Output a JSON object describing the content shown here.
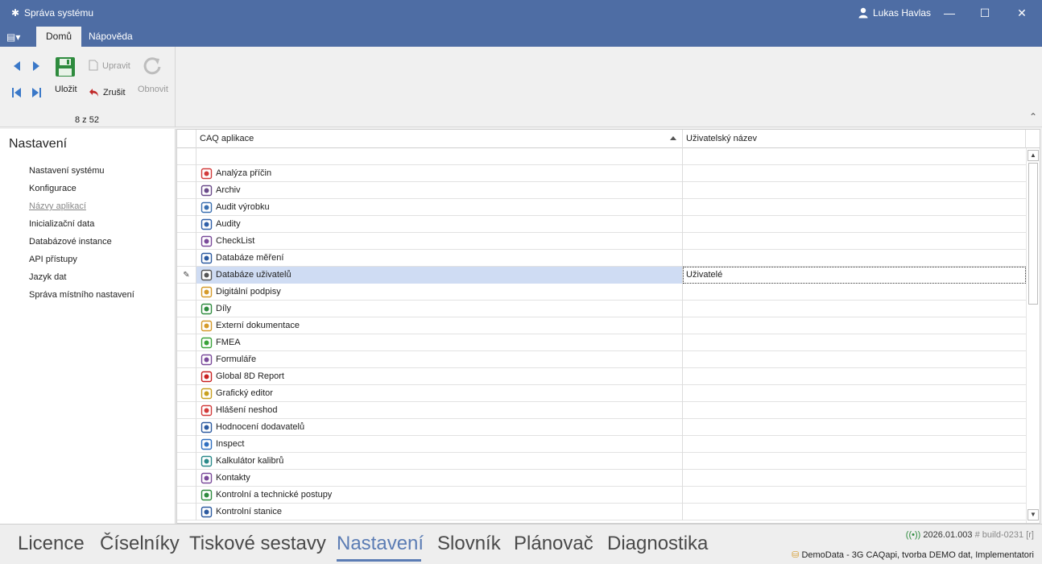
{
  "window": {
    "title": "Správa systému",
    "user": "Lukas Havlas",
    "minimize": "—",
    "maximize": "☐",
    "close": "✕"
  },
  "ribbon": {
    "menu_glyph": "▤▾",
    "tabs": [
      {
        "label": "Domů",
        "active": true
      },
      {
        "label": "Nápověda",
        "active": false
      }
    ],
    "save_label": "Uložit",
    "edit_label": "Upravit",
    "cancel_label": "Zrušit",
    "refresh_label": "Obnovit",
    "record_counter": "8 z 52",
    "collapse_glyph": "⌃"
  },
  "leftnav": {
    "heading": "Nastavení",
    "items": [
      {
        "label": "Nastavení systému"
      },
      {
        "label": "Konfigurace"
      },
      {
        "label": "Názvy aplikací",
        "active": true
      },
      {
        "label": "Inicializační data"
      },
      {
        "label": "Databázové instance"
      },
      {
        "label": "API přístupy"
      },
      {
        "label": "Jazyk dat"
      },
      {
        "label": "Správa místního nastavení"
      }
    ]
  },
  "grid": {
    "columns": [
      "CAQ aplikace",
      "Uživatelský název"
    ],
    "edit_indicator": "✎",
    "rows": [
      {
        "app": "Analýza příčin",
        "user_name": "",
        "icon": "root-cause-icon",
        "color": "#d23b3b"
      },
      {
        "app": "Archiv",
        "user_name": "",
        "icon": "archive-icon",
        "color": "#6a4a8a"
      },
      {
        "app": "Audit výrobku",
        "user_name": "",
        "icon": "product-audit-icon",
        "color": "#3a6fb0"
      },
      {
        "app": "Audity",
        "user_name": "",
        "icon": "audit-icon",
        "color": "#2f5fa8"
      },
      {
        "app": "CheckList",
        "user_name": "",
        "icon": "checklist-icon",
        "color": "#7a4a9a"
      },
      {
        "app": "Databáze měření",
        "user_name": "",
        "icon": "measurement-db-icon",
        "color": "#2c5aa0"
      },
      {
        "app": "Databáze uživatelů",
        "user_name": "Uživatelé",
        "icon": "user-db-icon",
        "color": "#555555",
        "selected": true
      },
      {
        "app": "Digitální podpisy",
        "user_name": "",
        "icon": "digital-signature-icon",
        "color": "#d59a2a"
      },
      {
        "app": "Díly",
        "user_name": "",
        "icon": "parts-icon",
        "color": "#2e8b3e"
      },
      {
        "app": "Externí dokumentace",
        "user_name": "",
        "icon": "external-docs-icon",
        "color": "#d59a2a"
      },
      {
        "app": "FMEA",
        "user_name": "",
        "icon": "fmea-icon",
        "color": "#3aa23a"
      },
      {
        "app": "Formuláře",
        "user_name": "",
        "icon": "forms-icon",
        "color": "#7a4a9a"
      },
      {
        "app": "Global 8D Report",
        "user_name": "",
        "icon": "8d-report-icon",
        "color": "#c82020"
      },
      {
        "app": "Grafický editor",
        "user_name": "",
        "icon": "graphic-editor-icon",
        "color": "#c8a020"
      },
      {
        "app": "Hlášení neshod",
        "user_name": "",
        "icon": "nonconformity-icon",
        "color": "#d23b3b"
      },
      {
        "app": "Hodnocení dodavatelů",
        "user_name": "",
        "icon": "supplier-rating-icon",
        "color": "#2c5aa0"
      },
      {
        "app": "Inspect",
        "user_name": "",
        "icon": "inspect-icon",
        "color": "#2f6fc0"
      },
      {
        "app": "Kalkulátor kalibrů",
        "user_name": "",
        "icon": "gauge-calculator-icon",
        "color": "#2a8a8a"
      },
      {
        "app": "Kontakty",
        "user_name": "",
        "icon": "contacts-icon",
        "color": "#7a4a9a"
      },
      {
        "app": "Kontrolní a technické postupy",
        "user_name": "",
        "icon": "procedures-icon",
        "color": "#2e8b3e"
      },
      {
        "app": "Kontrolní stanice",
        "user_name": "",
        "icon": "inspection-station-icon",
        "color": "#2c5aa0"
      }
    ]
  },
  "bottom_nav": {
    "items": [
      {
        "label": "Licence"
      },
      {
        "label": "Číselníky"
      },
      {
        "label": "Tiskové sestavy"
      },
      {
        "label": "Nastavení",
        "active": true
      },
      {
        "label": "Slovník"
      },
      {
        "label": "Plánovač"
      },
      {
        "label": "Diagnostika"
      }
    ]
  },
  "status": {
    "version": "2026.01.003",
    "build": "# build-0231 [r]",
    "database": "DemoData - 3G CAQapi, tvorba DEMO dat, Implementatori"
  },
  "colors": {
    "titlebar": "#4e6da4",
    "accent": "#5b7cb4",
    "selection": "#cfdcf3",
    "save_green": "#2e8b3e",
    "nav_blue": "#3a78c8",
    "cancel_red": "#c02828"
  }
}
